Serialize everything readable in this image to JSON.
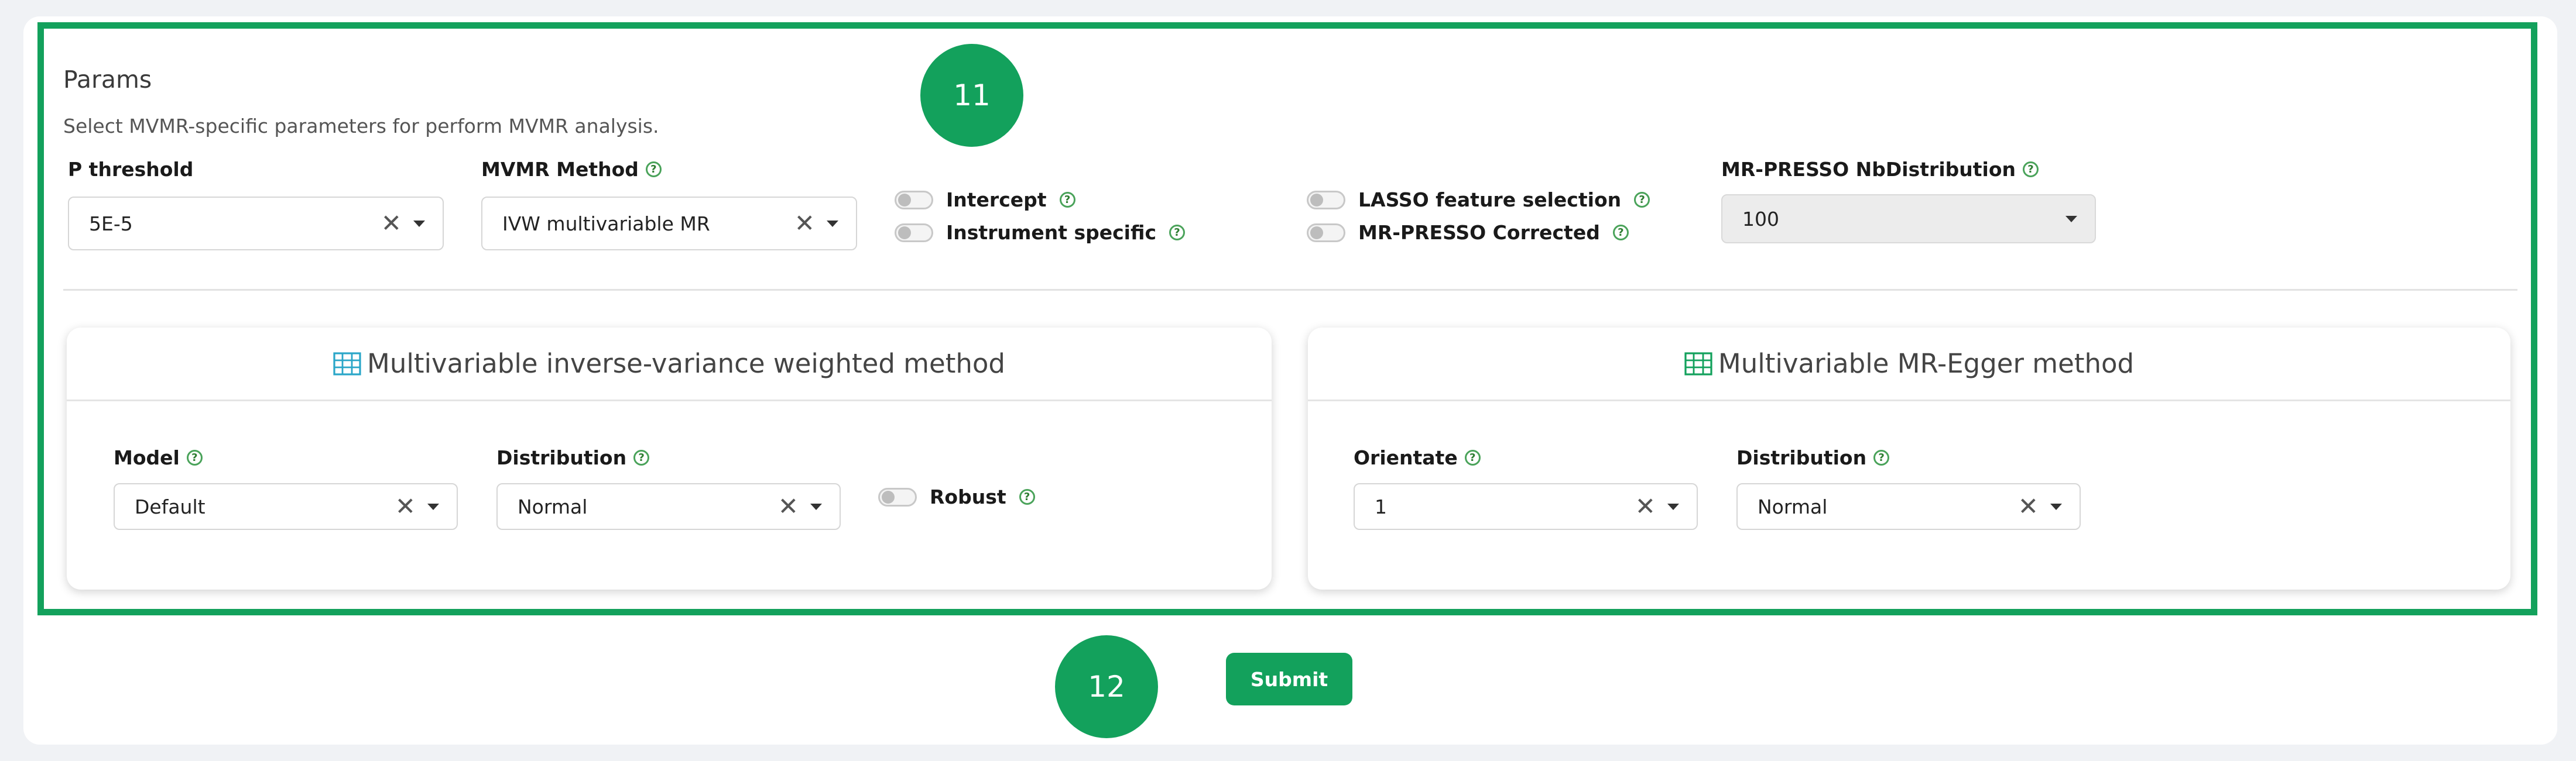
{
  "params": {
    "title": "Params",
    "subtitle": "Select MVMR-specific parameters for perform MVMR analysis."
  },
  "badges": {
    "top": "11",
    "bottom": "12"
  },
  "fields": {
    "p_threshold": {
      "label": "P threshold",
      "value": "5E-5"
    },
    "mvmr_method": {
      "label": "MVMR Method",
      "value": "IVW multivariable MR"
    },
    "nb_distribution": {
      "label": "MR-PRESSO NbDistribution",
      "value": "100"
    }
  },
  "toggles": {
    "intercept": "Intercept",
    "instrument_specific": "Instrument specific",
    "lasso": "LASSO feature selection",
    "presso_corrected": "MR-PRESSO Corrected",
    "robust": "Robust"
  },
  "ivw_panel": {
    "title": "Multivariable inverse-variance weighted method",
    "model": {
      "label": "Model",
      "value": "Default"
    },
    "distribution": {
      "label": "Distribution",
      "value": "Normal"
    }
  },
  "egger_panel": {
    "title": "Multivariable MR-Egger method",
    "orientate": {
      "label": "Orientate",
      "value": "1"
    },
    "distribution": {
      "label": "Distribution",
      "value": "Normal"
    }
  },
  "help_glyph": "?",
  "clear_glyph": "✕",
  "submit_label": "Submit",
  "colors": {
    "accent": "#13a15c",
    "table_icon": "#2aa6c8"
  }
}
